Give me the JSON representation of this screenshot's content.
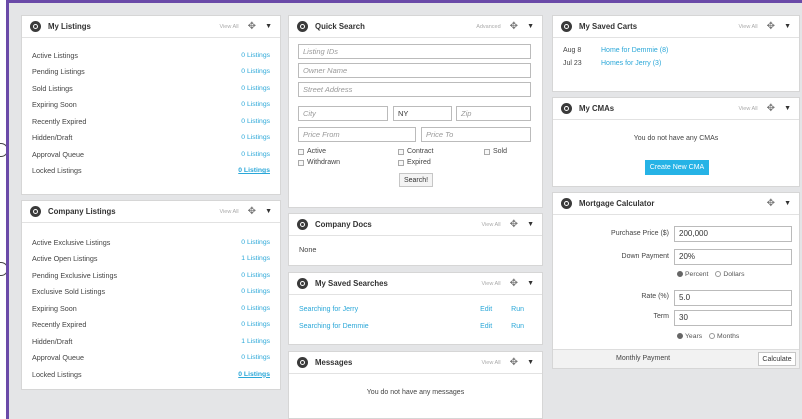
{
  "icons": {
    "panel": "settings-icon",
    "move": "move-icon",
    "menu": "caret-down-icon"
  },
  "colors": {
    "accent": "#2aa7d8",
    "frame_border": "#6a4aa8",
    "primary_button": "#26b3e6"
  },
  "my_listings": {
    "title": "My Listings",
    "view_all": "View All",
    "rows": [
      {
        "label": "Active Listings",
        "value": "0 Listings"
      },
      {
        "label": "Pending Listings",
        "value": "0 Listings"
      },
      {
        "label": "Sold Listings",
        "value": "0 Listings"
      },
      {
        "label": "Expiring Soon",
        "value": "0 Listings"
      },
      {
        "label": "Recently Expired",
        "value": "0 Listings"
      },
      {
        "label": "Hidden/Draft",
        "value": "0 Listings"
      },
      {
        "label": "Approval Queue",
        "value": "0 Listings"
      },
      {
        "label": "Locked Listings",
        "value": "0 Listings"
      }
    ]
  },
  "company_listings": {
    "title": "Company Listings",
    "view_all": "View All",
    "rows": [
      {
        "label": "Active Exclusive Listings",
        "value": "0 Listings"
      },
      {
        "label": "Active Open Listings",
        "value": "1 Listings"
      },
      {
        "label": "Pending Exclusive Listings",
        "value": "0 Listings"
      },
      {
        "label": "Exclusive Sold Listings",
        "value": "0 Listings"
      },
      {
        "label": "Expiring Soon",
        "value": "0 Listings"
      },
      {
        "label": "Recently Expired",
        "value": "0 Listings"
      },
      {
        "label": "Hidden/Draft",
        "value": "1 Listings"
      },
      {
        "label": "Approval Queue",
        "value": "0 Listings"
      },
      {
        "label": "Locked Listings",
        "value": "0 Listings"
      }
    ]
  },
  "quick_search": {
    "title": "Quick Search",
    "advanced": "Advanced",
    "listing_ids_placeholder": "Listing IDs",
    "owner_placeholder": "Owner Name",
    "street_placeholder": "Street Address",
    "city_placeholder": "City",
    "state_value": "NY",
    "zip_placeholder": "Zip",
    "price_from_placeholder": "Price From",
    "price_to_placeholder": "Price To",
    "status": {
      "active": "Active",
      "contract": "Contract",
      "sold": "Sold",
      "withdrawn": "Withdrawn",
      "expired": "Expired"
    },
    "search_button": "Search!"
  },
  "company_docs": {
    "title": "Company Docs",
    "view_all": "View All",
    "content": "None"
  },
  "saved_searches": {
    "title": "My Saved Searches",
    "view_all": "View All",
    "edit": "Edit",
    "run": "Run",
    "items": [
      "Searching for Jerry",
      "Searching for Demmie"
    ]
  },
  "messages": {
    "title": "Messages",
    "view_all": "View All",
    "empty": "You do not have any messages"
  },
  "saved_carts": {
    "title": "My Saved Carts",
    "view_all": "View All",
    "items": [
      {
        "date": "Aug 8",
        "name": "Home for Demmie (8)"
      },
      {
        "date": "Jul 23",
        "name": "Homes for Jerry (3)"
      }
    ]
  },
  "cmas": {
    "title": "My CMAs",
    "view_all": "View All",
    "empty": "You do not have any CMAs",
    "create_button": "Create New CMA"
  },
  "mortgage": {
    "title": "Mortgage Calculator",
    "purchase_label": "Purchase Price ($)",
    "purchase_value": "200,000",
    "down_label": "Down Payment",
    "down_value": "20%",
    "down_unit_percent": "Percent",
    "down_unit_dollars": "Dollars",
    "down_unit_selected": "Percent",
    "rate_label": "Rate (%)",
    "rate_value": "5.0",
    "term_label": "Term",
    "term_value": "30",
    "term_unit_years": "Years",
    "term_unit_months": "Months",
    "term_unit_selected": "Years",
    "monthly_label": "Monthly Payment",
    "calculate_button": "Calculate"
  }
}
